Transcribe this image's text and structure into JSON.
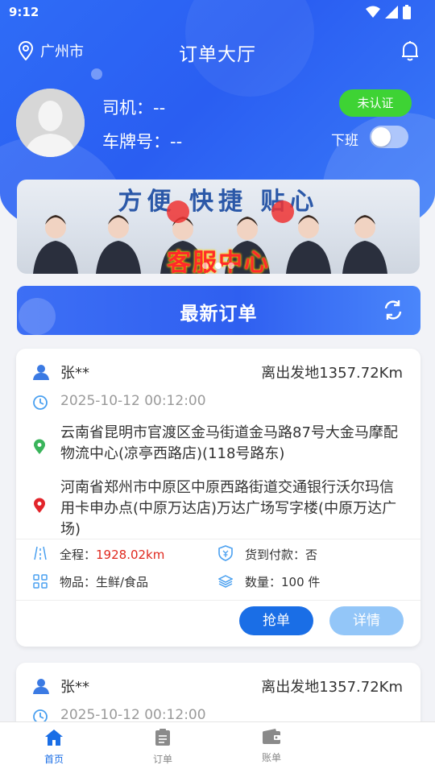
{
  "status_bar": {
    "time": "9:12"
  },
  "header": {
    "city": "广州市",
    "title": "订单大厅"
  },
  "driver": {
    "driver_label": "司机：--",
    "plate_label": "车牌号：--",
    "verify_badge": "未认证",
    "duty_label": "下班",
    "duty_on": false
  },
  "banner": {
    "slogan": "方便  快捷  贴心",
    "center_text": "客服中心",
    "slide_count": 3,
    "active_slide": 1
  },
  "latest": {
    "title": "最新订单"
  },
  "orders": [
    {
      "customer": "张**",
      "distance": "离出发地1357.72Km",
      "datetime": "2025-10-12 00:12:00",
      "from_address": "云南省昆明市官渡区金马街道金马路87号大金马摩配物流中心(凉亭西路店)(118号路东)",
      "to_address": "河南省郑州市中原区中原西路街道交通银行沃尔玛信用卡申办点(中原万达店)万达广场写字楼(中原万达广场)",
      "total_label": "全程：",
      "total_value": "1928.02km",
      "cod_label": "货到付款：否",
      "goods_label": "物品：生鲜/食品",
      "qty_label": "数量：100 件",
      "grab_btn": "抢单",
      "detail_btn": "详情"
    },
    {
      "customer": "张**",
      "distance": "离出发地1357.72Km",
      "datetime": "2025-10-12 00:12:00"
    }
  ],
  "tabs": [
    {
      "label": "首页",
      "icon": "home-icon",
      "active": true
    },
    {
      "label": "订单",
      "icon": "orders-icon",
      "active": false
    },
    {
      "label": "账单",
      "icon": "wallet-icon",
      "active": false
    }
  ],
  "colors": {
    "primary": "#2f6cf6",
    "accent_blue": "#1a6ee6",
    "badge_green": "#3ed334",
    "distance_red": "#e0281e"
  }
}
